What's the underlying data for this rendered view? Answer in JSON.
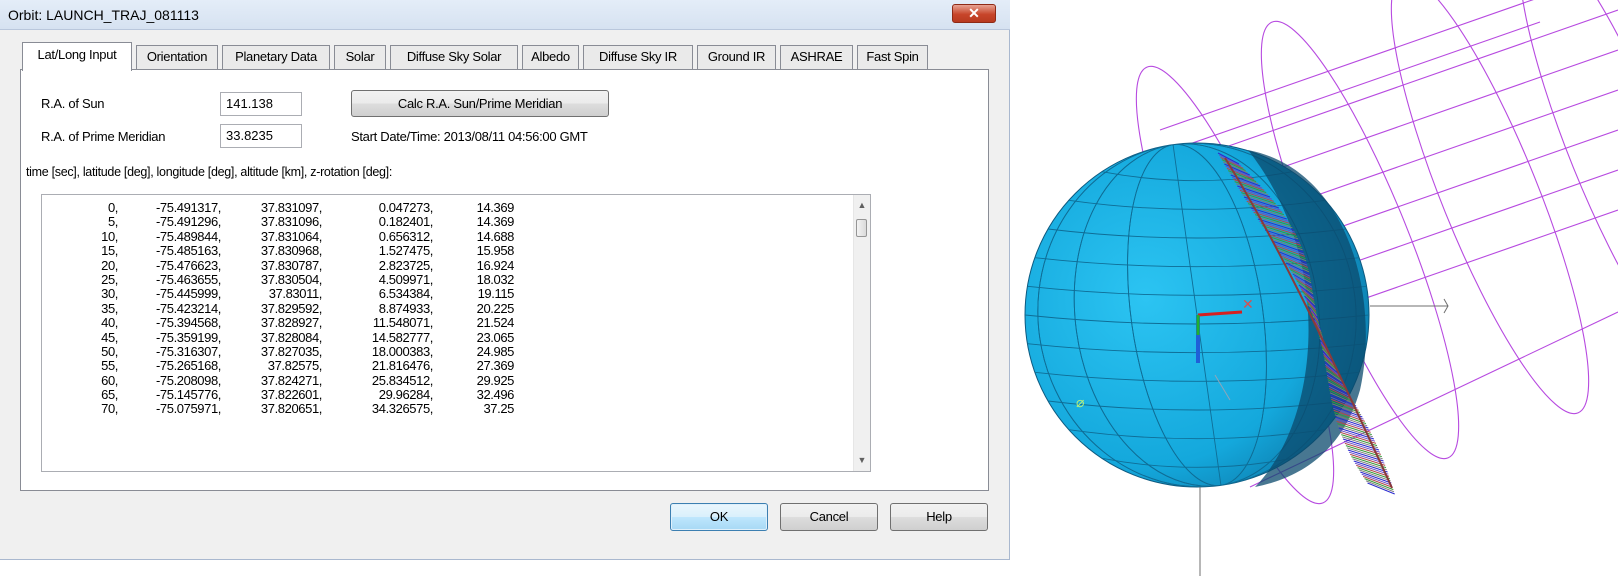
{
  "dialog": {
    "title": "Orbit: LAUNCH_TRAJ_081113",
    "close_glyph": "✕",
    "tabs": [
      {
        "label": "Lat/Long Input"
      },
      {
        "label": "Orientation"
      },
      {
        "label": "Planetary Data"
      },
      {
        "label": "Solar"
      },
      {
        "label": "Diffuse Sky Solar"
      },
      {
        "label": "Albedo"
      },
      {
        "label": "Diffuse Sky IR"
      },
      {
        "label": "Ground IR"
      },
      {
        "label": "ASHRAE"
      },
      {
        "label": "Fast Spin"
      }
    ],
    "active_tab": "Lat/Long Input",
    "ra_sun_label": "R.A. of Sun",
    "ra_sun_value": "141.138",
    "ra_prime_label": "R.A. of Prime Meridian",
    "ra_prime_value": "33.8235",
    "calc_button": "Calc R.A. Sun/Prime Meridian",
    "start_time": "Start Date/Time: 2013/08/11 04:56:00 GMT",
    "columns_label": "time [sec], latitude [deg], longitude [deg], altitude [km], z-rotation [deg]:",
    "rows": [
      [
        "0,",
        "-75.491317,",
        "37.831097,",
        "0.047273,",
        "14.369"
      ],
      [
        "5,",
        "-75.491296,",
        "37.831096,",
        "0.182401,",
        "14.369"
      ],
      [
        "10,",
        "-75.489844,",
        "37.831064,",
        "0.656312,",
        "14.688"
      ],
      [
        "15,",
        "-75.485163,",
        "37.830968,",
        "1.527475,",
        "15.958"
      ],
      [
        "20,",
        "-75.476623,",
        "37.830787,",
        "2.823725,",
        "16.924"
      ],
      [
        "25,",
        "-75.463655,",
        "37.830504,",
        "4.509971,",
        "18.032"
      ],
      [
        "30,",
        "-75.445999,",
        "37.83011,",
        "6.534384,",
        "19.115"
      ],
      [
        "35,",
        "-75.423214,",
        "37.829592,",
        "8.874933,",
        "20.225"
      ],
      [
        "40,",
        "-75.394568,",
        "37.828927,",
        "11.548071,",
        "21.524"
      ],
      [
        "45,",
        "-75.359199,",
        "37.828084,",
        "14.582777,",
        "23.065"
      ],
      [
        "50,",
        "-75.316307,",
        "37.827035,",
        "18.000383,",
        "24.985"
      ],
      [
        "55,",
        "-75.265168,",
        "37.82575,",
        "21.816476,",
        "27.369"
      ],
      [
        "60,",
        "-75.208098,",
        "37.824271,",
        "25.834512,",
        "29.925"
      ],
      [
        "65,",
        "-75.145776,",
        "37.822601,",
        "29.96284,",
        "32.496"
      ],
      [
        "70,",
        "-75.075971,",
        "37.820651,",
        "34.326575,",
        "37.25"
      ]
    ],
    "ok_button": "OK",
    "cancel_button": "Cancel",
    "help_button": "Help"
  },
  "viewport": {
    "globe_color": "#1ab2e6",
    "orbit_color": "#b74ae0"
  },
  "icons": {
    "close": "close-icon",
    "scroll_up": "scroll-up-arrow-icon",
    "scroll_down": "scroll-down-arrow-icon"
  }
}
